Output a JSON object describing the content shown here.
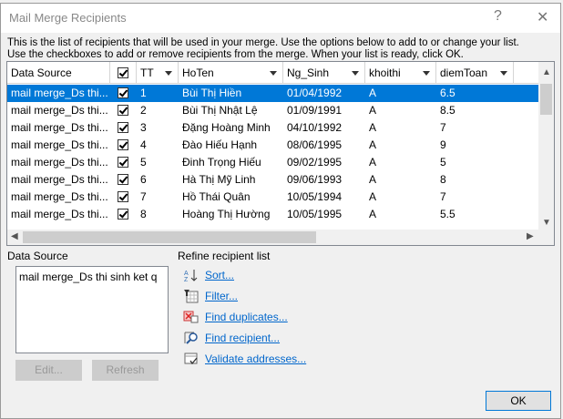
{
  "window": {
    "title": "Mail Merge Recipients",
    "help": "?",
    "close": "✕"
  },
  "instructions": [
    "This is the list of recipients that will be used in your merge.  Use the options below to add to or change your list.",
    "Use the checkboxes to add or remove recipients from the merge.  When your list is ready, click OK."
  ],
  "table": {
    "columns": [
      "Data Source",
      "",
      "TT",
      "HoTen",
      "Ng_Sinh",
      "khoithi",
      "diemToan"
    ],
    "rows": [
      {
        "source": "mail merge_Ds thi...",
        "checked": true,
        "tt": "1",
        "hoten": "Bùi Thị Hiền",
        "ngsinh": "01/04/1992",
        "khoithi": "A",
        "diem": "6.5"
      },
      {
        "source": "mail merge_Ds thi...",
        "checked": true,
        "tt": "2",
        "hoten": "Bùi Thị Nhật Lệ",
        "ngsinh": "01/09/1991",
        "khoithi": "A",
        "diem": "8.5"
      },
      {
        "source": "mail merge_Ds thi...",
        "checked": true,
        "tt": "3",
        "hoten": "Đặng Hoàng Minh",
        "ngsinh": "04/10/1992",
        "khoithi": "A",
        "diem": "7"
      },
      {
        "source": "mail merge_Ds thi...",
        "checked": true,
        "tt": "4",
        "hoten": "Đào Hiếu Hạnh",
        "ngsinh": "08/06/1995",
        "khoithi": "A",
        "diem": "9"
      },
      {
        "source": "mail merge_Ds thi...",
        "checked": true,
        "tt": "5",
        "hoten": "Đinh Trọng Hiếu",
        "ngsinh": "09/02/1995",
        "khoithi": "A",
        "diem": "5"
      },
      {
        "source": "mail merge_Ds thi...",
        "checked": true,
        "tt": "6",
        "hoten": "Hà Thị Mỹ Linh",
        "ngsinh": "09/06/1993",
        "khoithi": "A",
        "diem": "8"
      },
      {
        "source": "mail merge_Ds thi...",
        "checked": true,
        "tt": "7",
        "hoten": "Hồ Thái Quân",
        "ngsinh": "10/05/1994",
        "khoithi": "A",
        "diem": "7"
      },
      {
        "source": "mail merge_Ds thi...",
        "checked": true,
        "tt": "8",
        "hoten": "Hoàng Thị Hường",
        "ngsinh": "10/05/1995",
        "khoithi": "A",
        "diem": "5.5"
      }
    ],
    "selected_row": 0
  },
  "data_source": {
    "label": "Data Source",
    "items": [
      "mail merge_Ds thi sinh ket q"
    ],
    "edit": "Edit...",
    "refresh": "Refresh"
  },
  "refine": {
    "label": "Refine recipient list",
    "links": [
      "Sort...",
      "Filter...",
      "Find duplicates...",
      "Find recipient...",
      "Validate addresses..."
    ]
  },
  "ok": "OK",
  "colors": {
    "selection": "#0078d7",
    "link": "#0066cc"
  }
}
